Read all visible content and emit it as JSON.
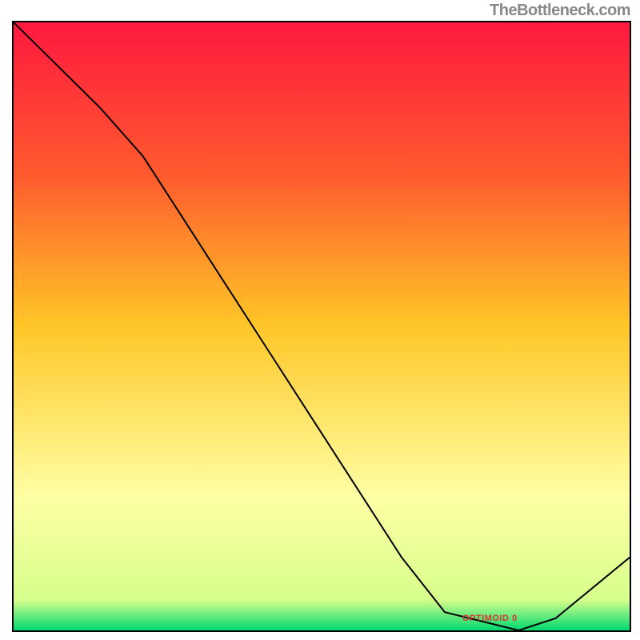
{
  "watermark": "TheBottleneck.com",
  "bottom_label": "OPTIMOID 0",
  "chart_data": {
    "type": "line",
    "title": "",
    "xlabel": "",
    "ylabel": "",
    "x": [
      0.0,
      0.07,
      0.14,
      0.21,
      0.28,
      0.35,
      0.42,
      0.49,
      0.56,
      0.63,
      0.7,
      0.82,
      0.88,
      1.0
    ],
    "values": [
      1.0,
      0.93,
      0.86,
      0.78,
      0.67,
      0.56,
      0.45,
      0.34,
      0.23,
      0.12,
      0.03,
      0.0,
      0.02,
      0.12
    ],
    "xlim": [
      0,
      1
    ],
    "ylim": [
      0,
      1
    ],
    "gradient_stops": [
      {
        "t": 0.0,
        "color": "#ff193f"
      },
      {
        "t": 0.25,
        "color": "#ff5a2e"
      },
      {
        "t": 0.5,
        "color": "#ffc727"
      },
      {
        "t": 0.78,
        "color": "#ffffa4"
      },
      {
        "t": 0.95,
        "color": "#d6ff8c"
      },
      {
        "t": 1.0,
        "color": "#00d96f"
      }
    ],
    "line_color": "#000000",
    "line_width": 2,
    "annotation": {
      "text": "OPTIMOID 0",
      "x": 0.8,
      "y": 0.015
    }
  }
}
